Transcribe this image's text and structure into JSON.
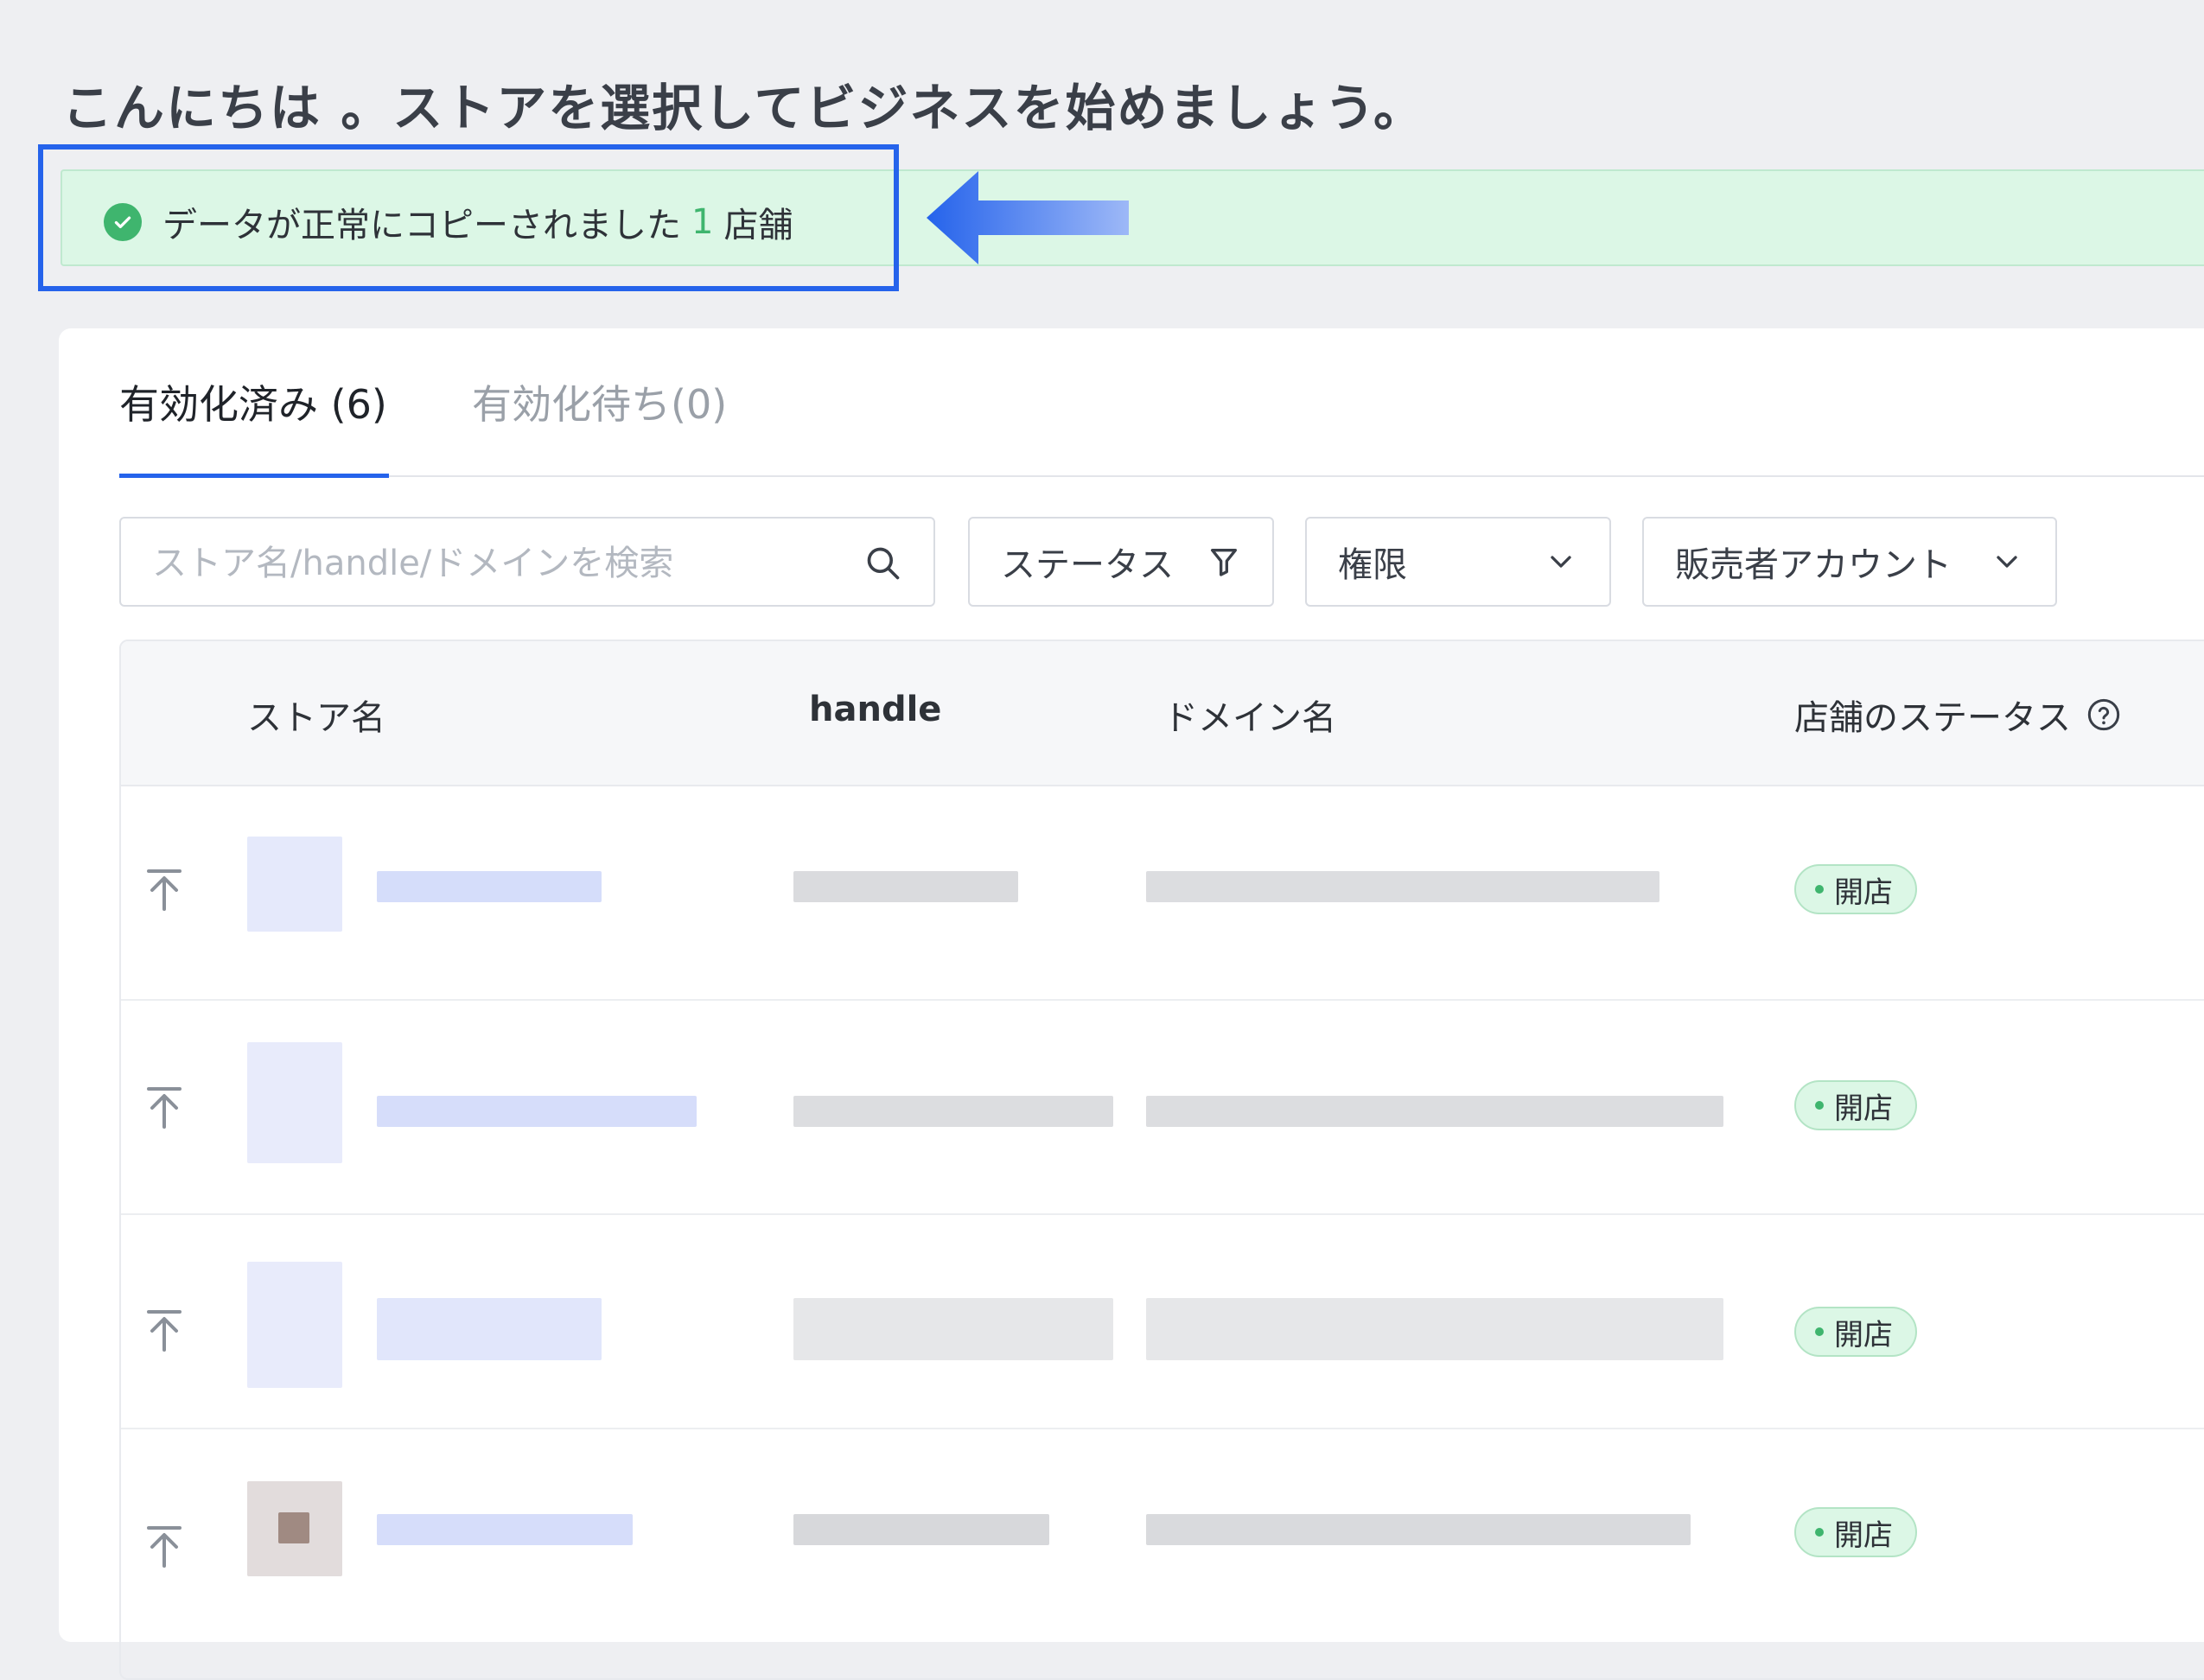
{
  "header": {
    "greeting": "こんにちは 。ストアを選択してビジネスを始めましょう。"
  },
  "banner": {
    "message": "データが正常にコピーされました",
    "count": "1",
    "unit": "店舗"
  },
  "tabs": [
    {
      "label": "有効化済み (6)",
      "active": true
    },
    {
      "label": "有効化待ち(0)",
      "active": false
    }
  ],
  "filters": {
    "search_placeholder": "ストア名/handle/ドメインを検索",
    "status_label": "ステータス",
    "permission_label": "権限",
    "seller_account_label": "販売者アカウント"
  },
  "table": {
    "columns": [
      "ストア名",
      "handle",
      "ドメイン名",
      "店舗のステータス"
    ],
    "rows": [
      {
        "status": "開店"
      },
      {
        "status": "開店"
      },
      {
        "status": "開店"
      },
      {
        "status": "開店"
      }
    ]
  },
  "colors": {
    "accent": "#2563eb",
    "success": "#3fb56e",
    "banner_bg": "#dcf7e6"
  }
}
